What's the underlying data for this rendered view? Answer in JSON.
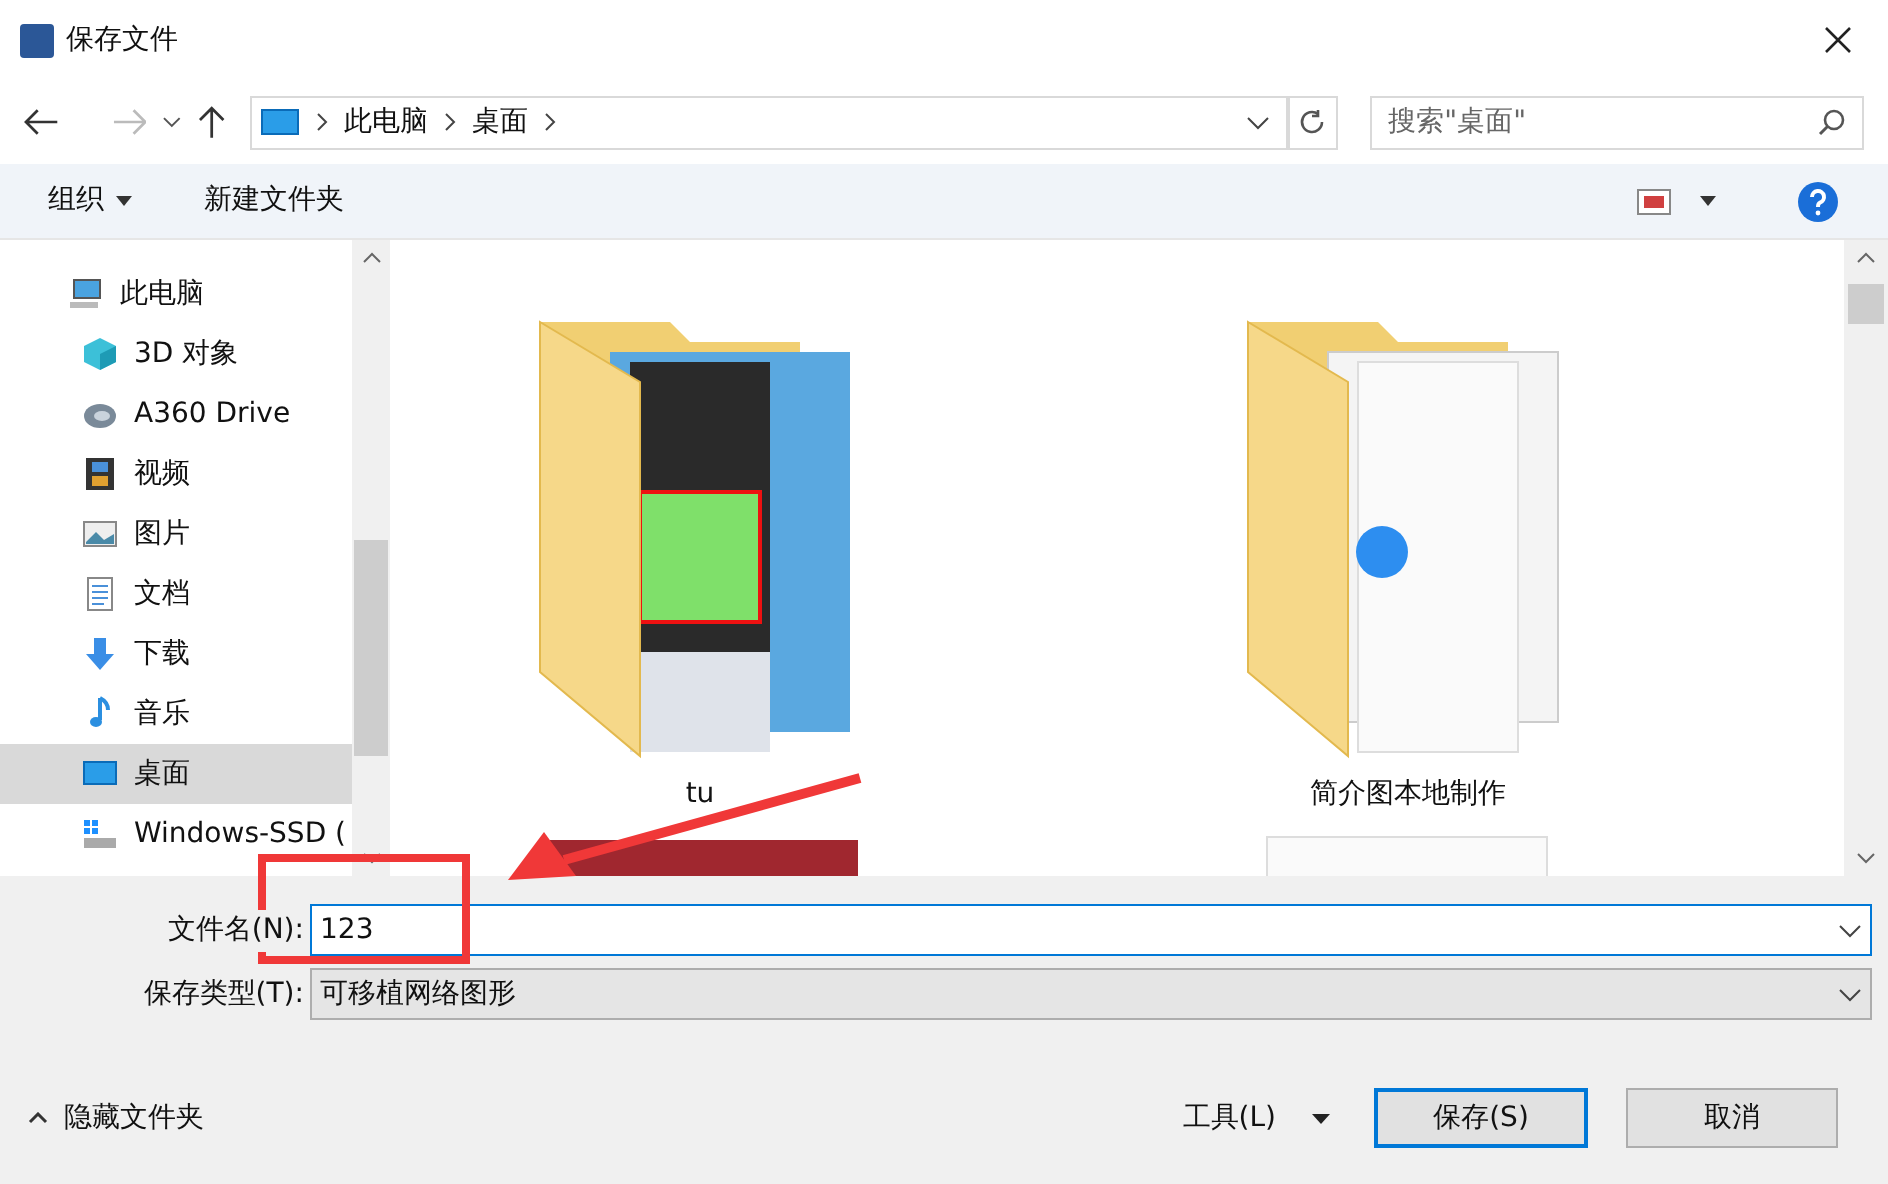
{
  "window": {
    "title": "保存文件"
  },
  "address": {
    "path": [
      {
        "label": "此电脑"
      },
      {
        "label": "桌面"
      }
    ],
    "search_placeholder": "搜索\"桌面\""
  },
  "toolbar": {
    "organize": "组织",
    "new_folder": "新建文件夹"
  },
  "sidebar": {
    "items": [
      {
        "label": "此电脑",
        "kind": "pc",
        "top": true,
        "selected": false
      },
      {
        "label": "3D 对象",
        "kind": "cube",
        "top": false,
        "selected": false
      },
      {
        "label": "A360 Drive",
        "kind": "cloud",
        "top": false,
        "selected": false
      },
      {
        "label": "视频",
        "kind": "video",
        "top": false,
        "selected": false
      },
      {
        "label": "图片",
        "kind": "picture",
        "top": false,
        "selected": false
      },
      {
        "label": "文档",
        "kind": "document",
        "top": false,
        "selected": false
      },
      {
        "label": "下载",
        "kind": "download",
        "top": false,
        "selected": false
      },
      {
        "label": "音乐",
        "kind": "music",
        "top": false,
        "selected": false
      },
      {
        "label": "桌面",
        "kind": "desktop",
        "top": false,
        "selected": true
      },
      {
        "label": "Windows-SSD (",
        "kind": "drive",
        "top": false,
        "selected": false
      }
    ]
  },
  "files": [
    {
      "label": "tu",
      "kind": "photo"
    },
    {
      "label": "简介图本地制作",
      "kind": "document"
    }
  ],
  "form": {
    "filename_label": "文件名(N):",
    "filename": "123",
    "type_label": "保存类型(T):",
    "type": "可移植网络图形"
  },
  "footer": {
    "hide_folders": "隐藏文件夹",
    "tools": "工具(L)",
    "save": "保存(S)",
    "cancel": "取消"
  }
}
